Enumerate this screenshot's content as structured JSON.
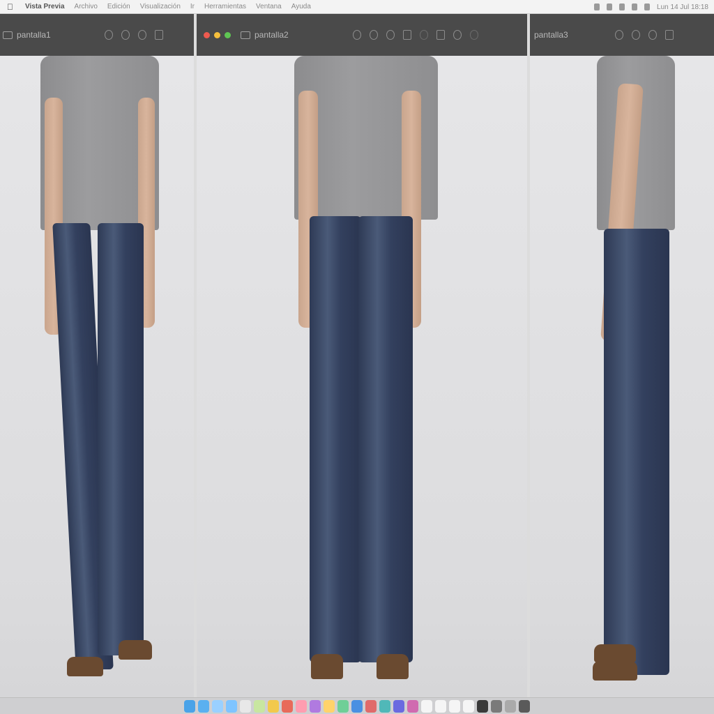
{
  "menubar": {
    "app_name": "Vista Previa",
    "menus": [
      "Archivo",
      "Edición",
      "Visualización",
      "Ir",
      "Herramientas",
      "Ventana",
      "Ayuda"
    ],
    "clock": "Lun 14 Jul 18:18"
  },
  "windows": [
    {
      "title": "pantalla1",
      "active": false
    },
    {
      "title": "pantalla2",
      "active": true
    },
    {
      "title": "pantalla3",
      "active": false
    }
  ],
  "colors": {
    "titlebar": "#4a4a4a",
    "close": "#ee5a4f",
    "minimize": "#f5bf3c",
    "zoom": "#5fc553"
  },
  "dock": {
    "icon_colors": [
      "#4aa3e8",
      "#5ab0f0",
      "#9ad0ff",
      "#7fc4ff",
      "#e8e8e8",
      "#c8e6a0",
      "#f2c94c",
      "#e86a5a",
      "#ff9db0",
      "#b07ae0",
      "#ffd36b",
      "#6fcf97",
      "#4a90e2",
      "#e06a6a",
      "#50b8b8",
      "#6a6ae0",
      "#d06ab0",
      "#f5f5f5",
      "#f5f5f5",
      "#f5f5f5",
      "#f5f5f5",
      "#3a3a3a",
      "#7a7a7a",
      "#aaaaaa",
      "#5a5a5a"
    ]
  }
}
